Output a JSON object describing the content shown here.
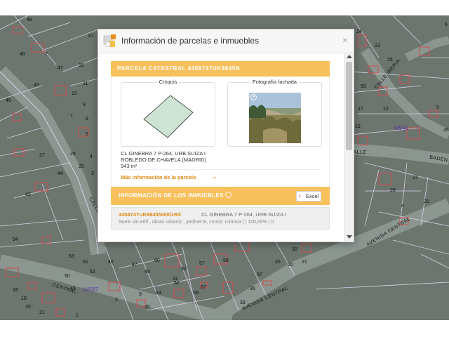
{
  "dialog": {
    "title": "Información de parcelas e inmuebles",
    "close_label": "×"
  },
  "parcel": {
    "header": "PARCELA CATASTRAL 4458747UK9845N",
    "croquis_label": "Croquis",
    "fachada_label": "Fotografía fachada",
    "address_line1": "CL GINEBRA 7 P-264, URB SUIZA I",
    "address_line2": "ROBLEDO DE CHAVELA (MADRID)",
    "area": "943 m²",
    "more_info": "Más información de la parcela"
  },
  "inmuebles": {
    "header": "INFORMACIÓN DE LOS INMUEBLES",
    "excel_label": "Excel",
    "items": [
      {
        "reference": "4458747UK9845N0001RX",
        "address": "CL GINEBRA 7 P-264, URB SUIZA I",
        "detail": "Suelo sin edif., obras urbaniz., jardinería, constr. ruinosa |  | 100,00% | 0"
      }
    ]
  },
  "map": {
    "parcel_numbers": [
      "49",
      "10",
      "7",
      "48",
      "47",
      "16",
      "43",
      "11",
      "12",
      "46",
      "9",
      "8",
      "7",
      "26",
      "5",
      "25",
      "27",
      "4",
      "3",
      "44",
      "42",
      "54",
      "53",
      "52",
      "51",
      "50",
      "49",
      "18",
      "19",
      "20",
      "21",
      "1",
      "2",
      "3",
      "60",
      "62",
      "63",
      "66",
      "67",
      "45",
      "46",
      "47",
      "48",
      "57",
      "58",
      "33",
      "30",
      "27",
      "28",
      "29",
      "4",
      "6",
      "5",
      "55",
      "17",
      "19",
      "24",
      "23",
      "25",
      "26",
      "22",
      "20",
      "21",
      "35",
      "31",
      "32",
      "36",
      "37"
    ],
    "zones": [
      "44587",
      "M945"
    ],
    "streets": [
      "CALLE IBERIA",
      "CALLE",
      "BADEN",
      "CALLE",
      "AVENIDA CENTRAL",
      "AVENIDA CENTRAL",
      "CENTRAL"
    ]
  },
  "colors": {
    "accent": "#f8c05c",
    "link": "#e08a16",
    "map_bg": "#6c756e",
    "parcel_line": "#d9d0e8",
    "building": "#c65454"
  }
}
